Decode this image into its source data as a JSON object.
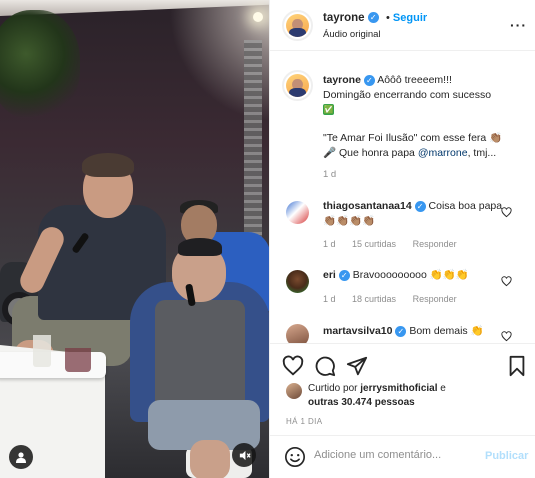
{
  "post": {
    "author": "tayrone",
    "follow_label": "Seguir",
    "audio_label": "Áudio original",
    "more_icon": "more-horizontal-icon",
    "caption": {
      "username": "tayrone",
      "line1": "Aôôô treeeem!!!",
      "line2": "Domingão encerrando com sucesso",
      "line3": "✅",
      "line4": "\"Te Amar Foi Ilusão\" com esse fera 👏🏽",
      "line5_prefix": "🎤 Que honra papa ",
      "mention": "@marrone",
      "line5_suffix": ", tmj...",
      "time": "1 d"
    },
    "colors": {
      "link": "#0095f6",
      "verified": "#3897f0",
      "muted": "#8e8e8e"
    }
  },
  "comments": [
    {
      "username": "thiagosantanaa14",
      "verified": true,
      "text": "Coisa boa papa 👏🏽👏🏽👏🏽👏🏽",
      "time": "1 d",
      "likes": "15 curtidas",
      "reply": "Responder"
    },
    {
      "username": "eri",
      "verified": true,
      "text": "Bravooooooooo 👏👏👏",
      "time": "1 d",
      "likes": "18 curtidas",
      "reply": "Responder"
    },
    {
      "username": "martavsilva10",
      "verified": true,
      "text": "Bom demais 👏",
      "time": "",
      "likes": "",
      "reply": ""
    }
  ],
  "actions": {
    "icons": [
      "heart-icon",
      "comment-icon",
      "share-icon",
      "bookmark-icon"
    ],
    "liked_by_prefix": "Curtido por ",
    "liked_by_user": "jerrysmithoficial",
    "liked_by_mid": " e",
    "liked_by_others": "outras 30.474 pessoas",
    "ago": "HÁ 1 DIA"
  },
  "comment_box": {
    "placeholder": "Adicione um comentário...",
    "publish_label": "Publicar"
  },
  "media": {
    "icons": [
      "user-tag-icon",
      "muted-speaker-icon"
    ]
  }
}
